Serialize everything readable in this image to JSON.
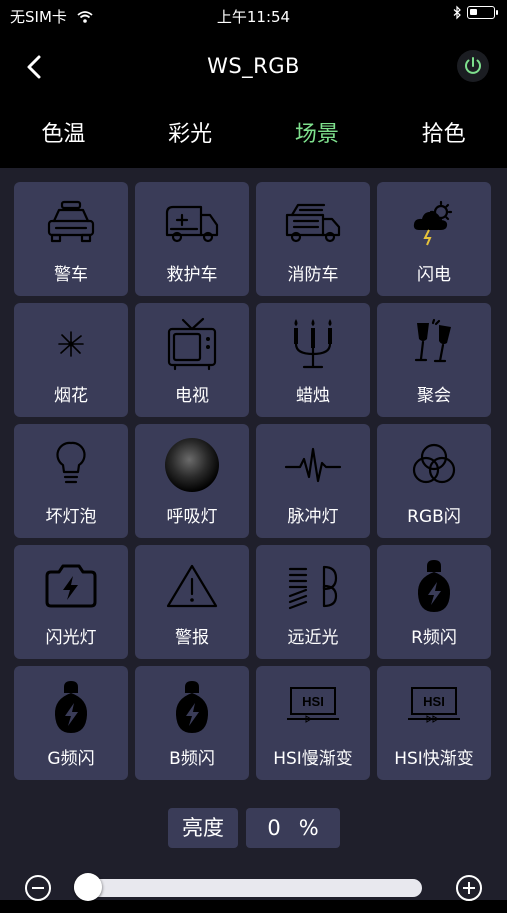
{
  "status_bar": {
    "carrier": "无SIM卡",
    "time": "上午11:54",
    "battery_level": 0.35
  },
  "header": {
    "title": "WS_RGB"
  },
  "tabs": [
    {
      "label": "色温",
      "active": false
    },
    {
      "label": "彩光",
      "active": false
    },
    {
      "label": "场景",
      "active": true
    },
    {
      "label": "拾色",
      "active": false
    }
  ],
  "scenes": [
    {
      "label": "警车",
      "icon": "police-car-icon"
    },
    {
      "label": "救护车",
      "icon": "ambulance-icon"
    },
    {
      "label": "消防车",
      "icon": "fire-truck-icon"
    },
    {
      "label": "闪电",
      "icon": "lightning-icon"
    },
    {
      "label": "烟花",
      "icon": "fireworks-icon"
    },
    {
      "label": "电视",
      "icon": "tv-icon"
    },
    {
      "label": "蜡烛",
      "icon": "candles-icon"
    },
    {
      "label": "聚会",
      "icon": "party-glasses-icon"
    },
    {
      "label": "坏灯泡",
      "icon": "bulb-icon"
    },
    {
      "label": "呼吸灯",
      "icon": "breathing-orb-icon"
    },
    {
      "label": "脉冲灯",
      "icon": "pulse-icon"
    },
    {
      "label": "RGB闪",
      "icon": "rgb-circles-icon"
    },
    {
      "label": "闪光灯",
      "icon": "camera-flash-icon"
    },
    {
      "label": "警报",
      "icon": "warning-icon"
    },
    {
      "label": "远近光",
      "icon": "headlight-icon"
    },
    {
      "label": "R频闪",
      "icon": "strobe-bulb-icon"
    },
    {
      "label": "G频闪",
      "icon": "strobe-bulb-icon"
    },
    {
      "label": "B频闪",
      "icon": "strobe-bulb-icon"
    },
    {
      "label": "HSI慢渐变",
      "icon": "hsi-slow-icon"
    },
    {
      "label": "HSI快渐变",
      "icon": "hsi-fast-icon"
    }
  ],
  "brightness": {
    "label": "亮度",
    "value": "0",
    "unit": "%",
    "level": 0
  },
  "colors": {
    "accent": "#7ee08d",
    "tile": "#3a3c58",
    "panel": "#1f1f2b"
  }
}
